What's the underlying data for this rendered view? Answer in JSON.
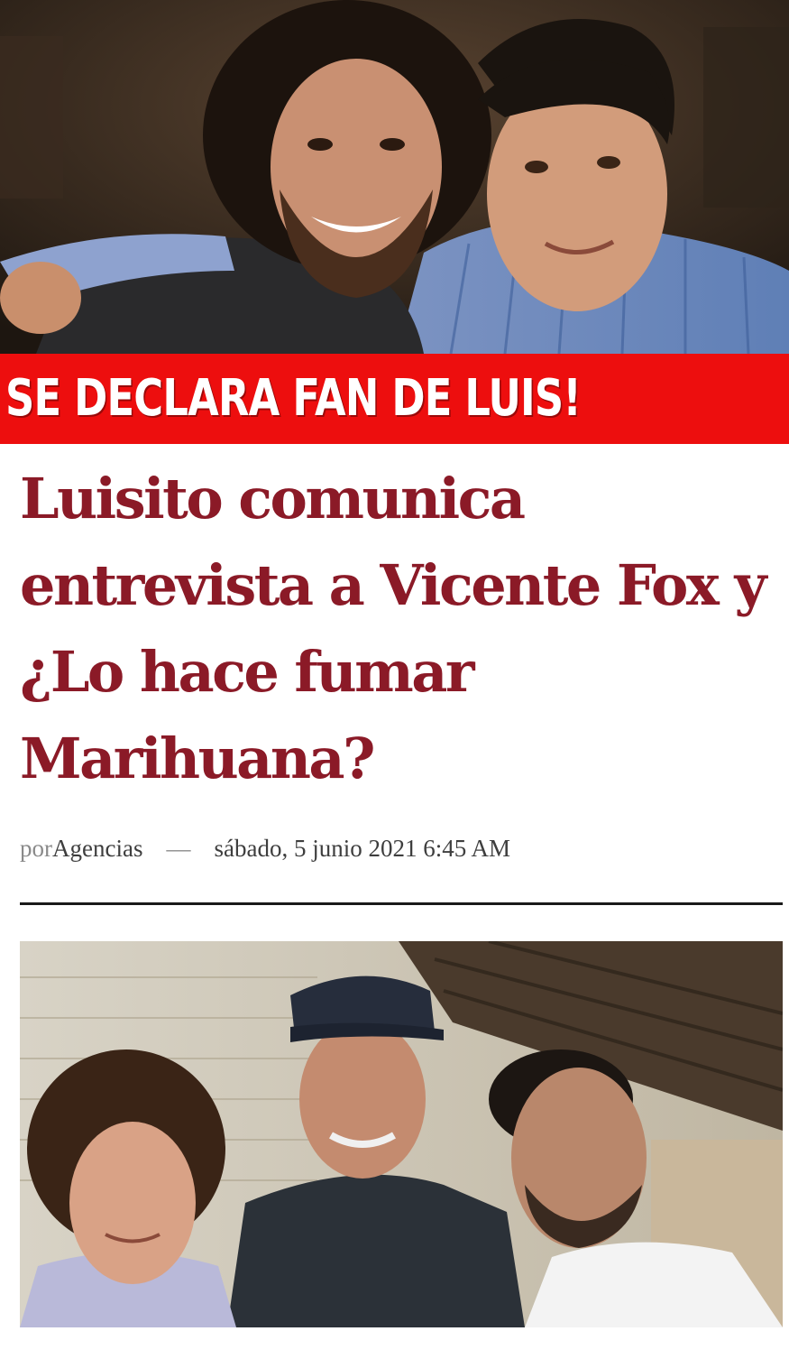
{
  "banner": {
    "text": "SE DECLARA FAN DE LUIS!",
    "background_color": "#ed0e0e",
    "text_color": "#ffffff"
  },
  "headline": {
    "text": "Luisito comunica entrevista a Vicente Fox y ¿Lo hace fumar Marihuana?",
    "color": "#8b1a27"
  },
  "byline": {
    "prefix": "por",
    "author": "Agencias",
    "separator": "—",
    "date": "sábado, 5 junio 2021 6:45 AM"
  }
}
